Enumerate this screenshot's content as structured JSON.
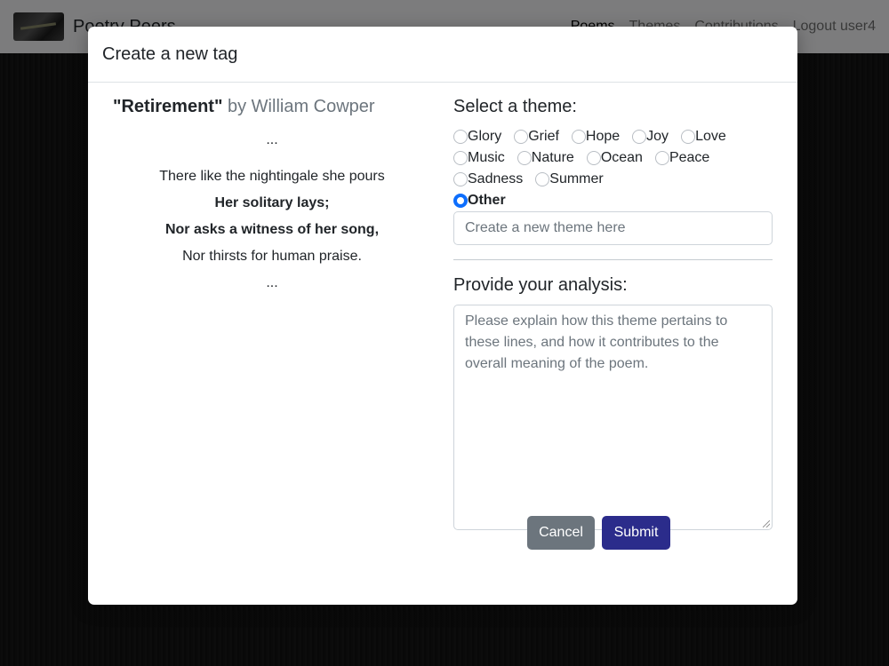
{
  "navbar": {
    "brand": "Poetry Peers",
    "links": [
      "Poems",
      "Themes",
      "Contributions",
      "Logout user4"
    ]
  },
  "modal": {
    "title": "Create a new tag",
    "poem": {
      "title": "\"Retirement\"",
      "author": "by William Cowper",
      "lines": [
        {
          "text": "...",
          "bold": false
        },
        {
          "text": "There like the nightingale she pours",
          "bold": false
        },
        {
          "text": "Her solitary lays;",
          "bold": true
        },
        {
          "text": "Nor asks a witness of her song,",
          "bold": true
        },
        {
          "text": "Nor thirsts for human praise.",
          "bold": false
        },
        {
          "text": "...",
          "bold": false
        }
      ]
    },
    "theme_heading": "Select a theme:",
    "themes": [
      "Glory",
      "Grief",
      "Hope",
      "Joy",
      "Love",
      "Music",
      "Nature",
      "Ocean",
      "Peace",
      "Sadness",
      "Summer",
      "Other"
    ],
    "selected_theme": "Other",
    "new_theme_placeholder": "Create a new theme here",
    "analysis_heading": "Provide your analysis:",
    "analysis_placeholder": "Please explain how this theme pertains to these lines, and how it contributes to the overall meaning of the poem.",
    "cancel_label": "Cancel",
    "submit_label": "Submit"
  },
  "colors": {
    "submit": "#2b2c8b",
    "cancel": "#6c757d",
    "radio_checked": "#0d6efd"
  }
}
